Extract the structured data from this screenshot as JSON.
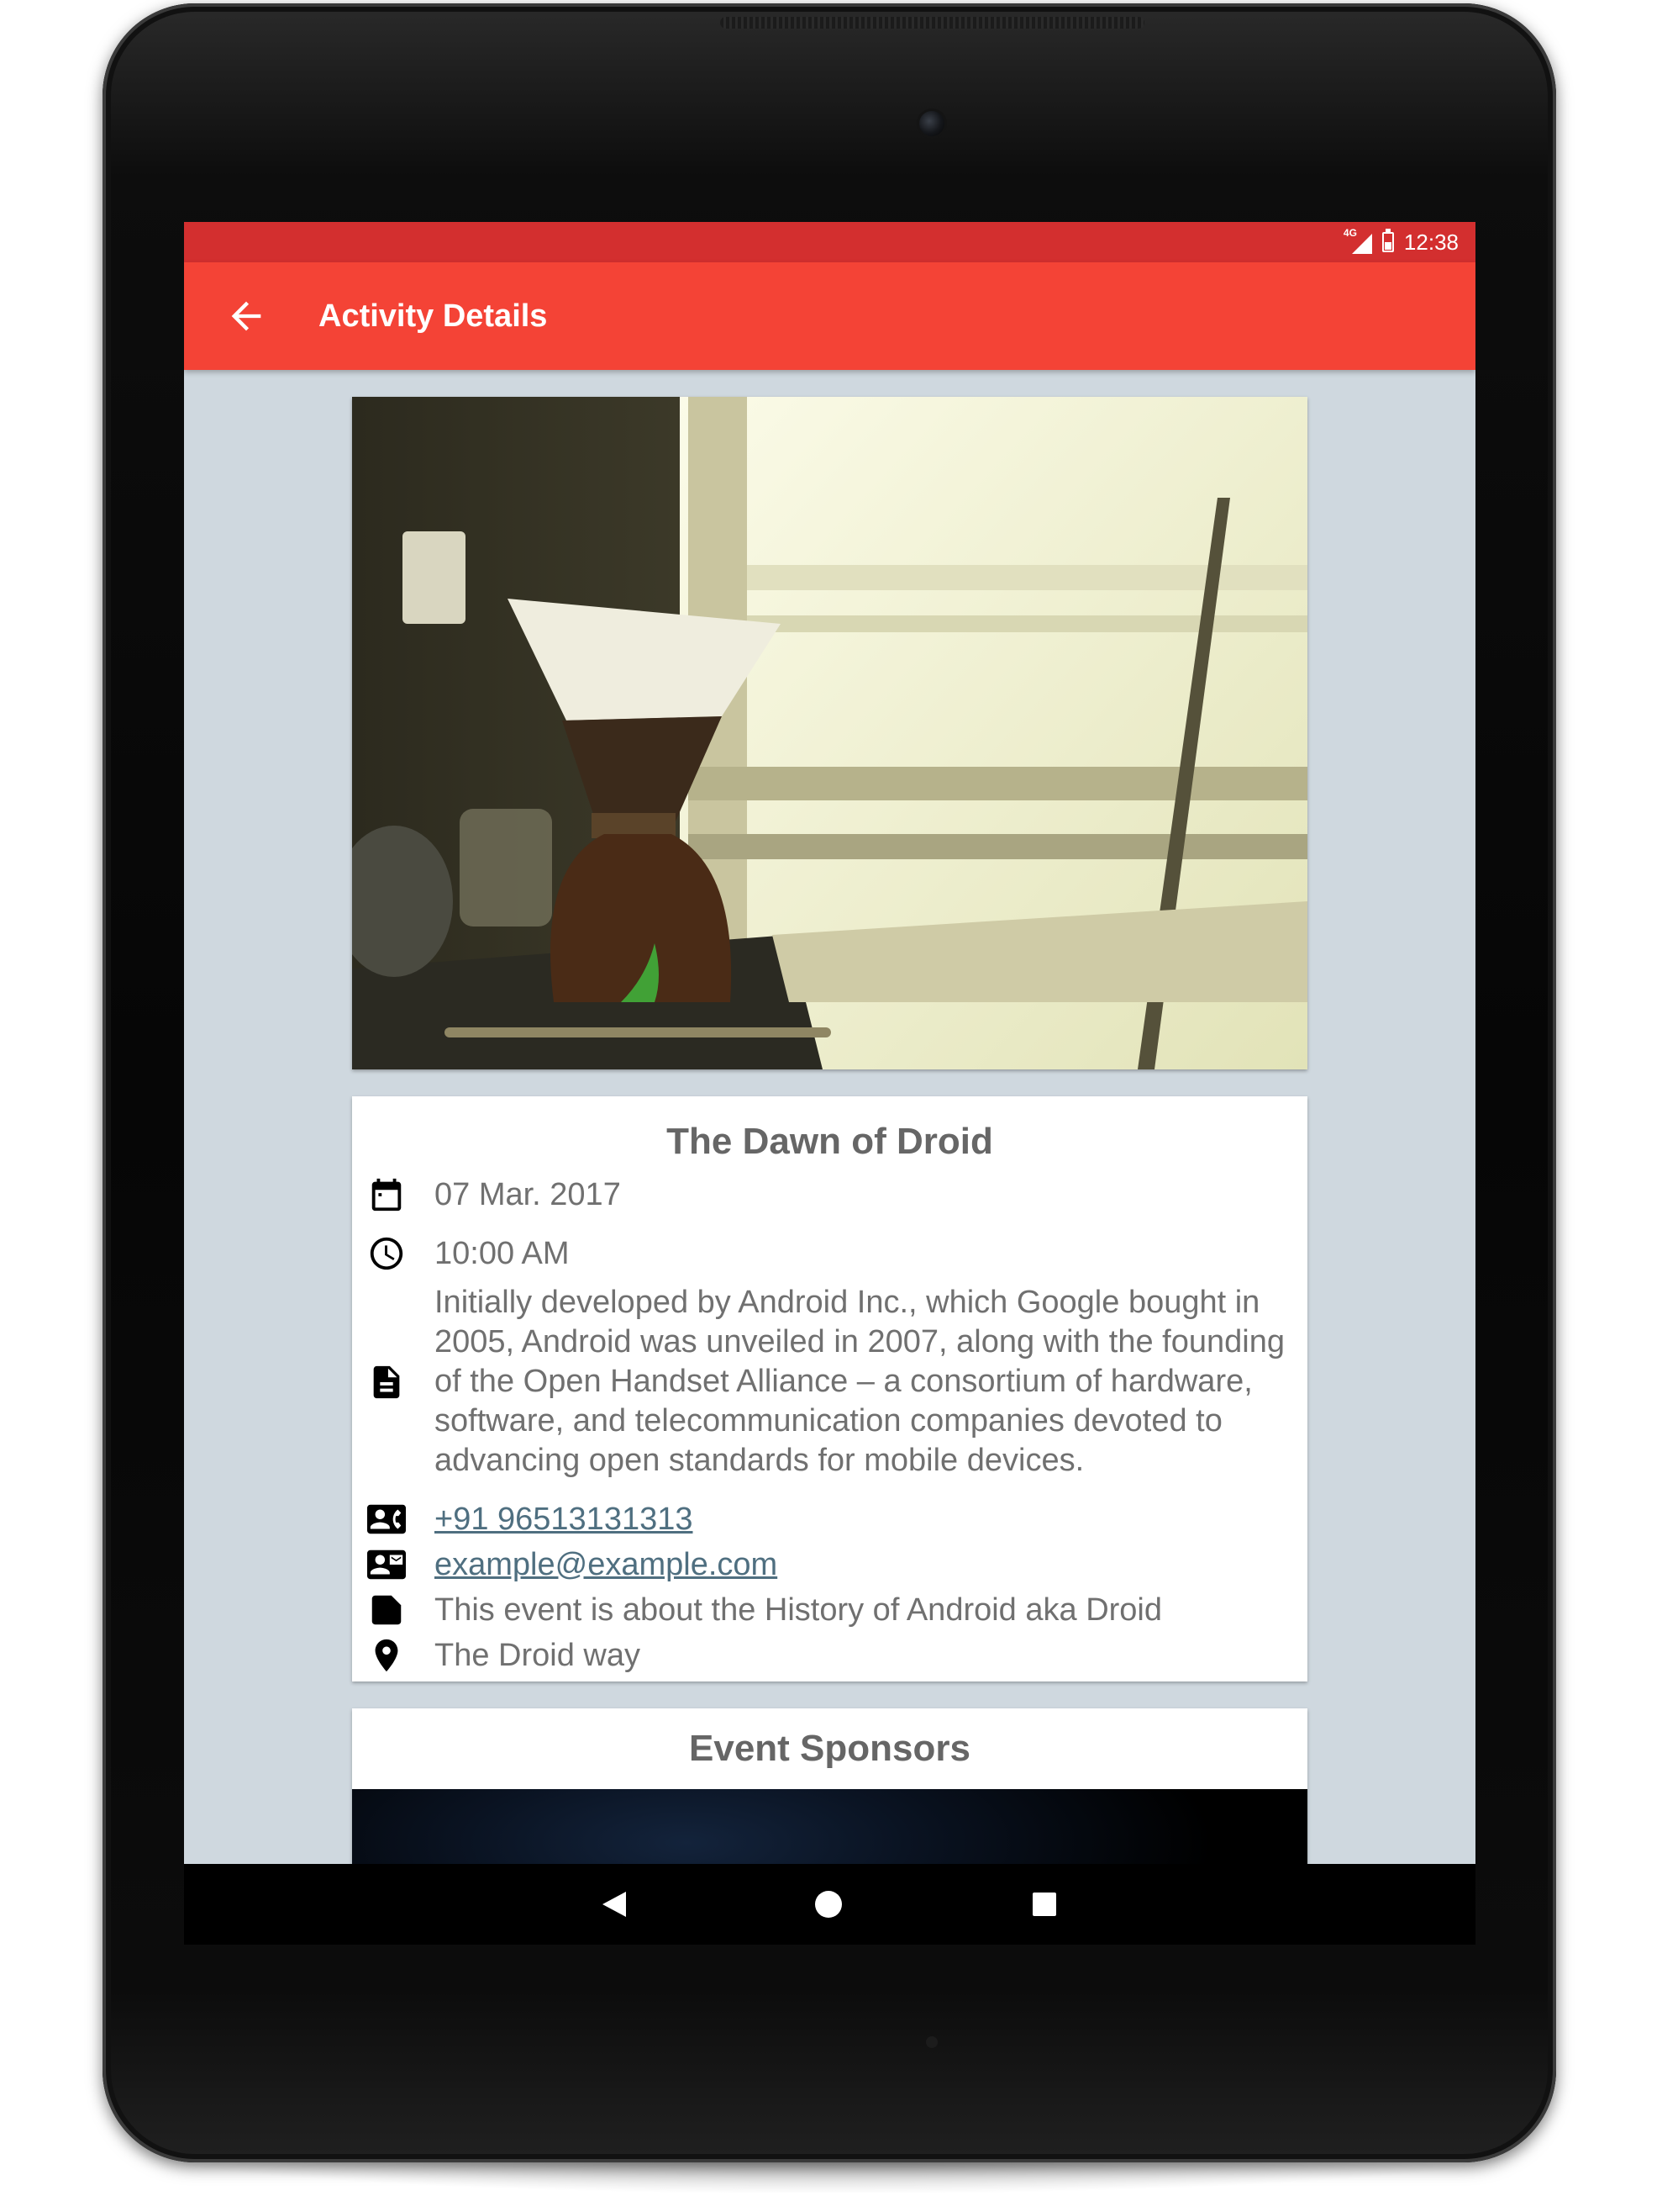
{
  "status_bar": {
    "network_type": "4G",
    "time": "12:38"
  },
  "app_bar": {
    "title": "Activity Details",
    "back_icon": "arrow-back-icon"
  },
  "colors": {
    "status_bar": "#d32f2f",
    "app_bar": "#f44336",
    "background": "#cfd8df",
    "link": "#4f6f80"
  },
  "event": {
    "title": "The Dawn of Droid",
    "date": "07 Mar. 2017",
    "time": "10:00 AM",
    "description": "Initially developed by Android Inc., which Google bought in 2005, Android was unveiled in 2007, along with the founding of the Open Handset Alliance – a consortium of hardware, software, and telecommunication companies devoted to advancing open standards for mobile devices.",
    "phone": "+91 96513131313",
    "email": "example@example.com",
    "category": "This event is about the History of Android aka Droid",
    "location": "The Droid way"
  },
  "sponsors": {
    "title": "Event Sponsors"
  },
  "icons": {
    "date": "calendar-icon",
    "time": "clock-icon",
    "description": "document-icon",
    "phone": "contact-phone-icon",
    "email": "contact-mail-icon",
    "category": "label-icon",
    "location": "location-pin-icon"
  },
  "nav_bar": {
    "back": "nav-back-icon",
    "home": "nav-home-icon",
    "recents": "nav-recents-icon"
  }
}
